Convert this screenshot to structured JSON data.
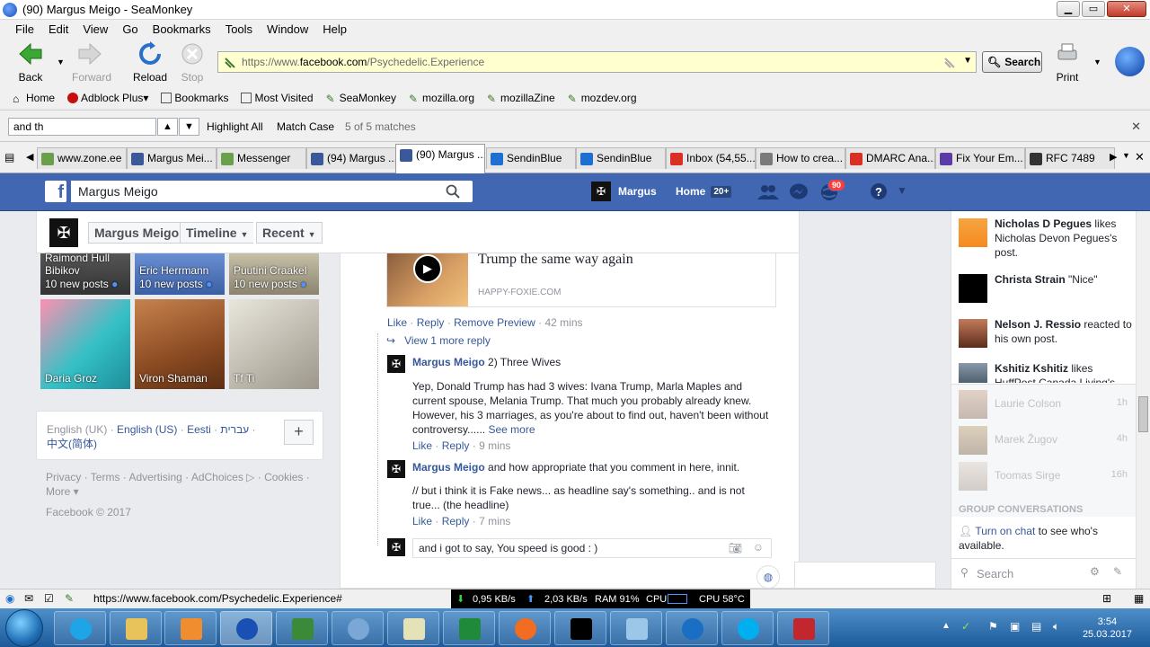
{
  "window": {
    "title": "(90) Margus Meigo - SeaMonkey"
  },
  "menu": [
    "File",
    "Edit",
    "View",
    "Go",
    "Bookmarks",
    "Tools",
    "Window",
    "Help"
  ],
  "nav": {
    "back": "Back",
    "forward": "Forward",
    "reload": "Reload",
    "stop": "Stop",
    "print": "Print",
    "search": "Search"
  },
  "url": {
    "prefix": "https://www.",
    "domain": "facebook.com",
    "path": "/Psychedelic.Experience"
  },
  "bookmarks": [
    "Home",
    "Adblock Plus",
    "Bookmarks",
    "Most Visited",
    "SeaMonkey",
    "mozilla.org",
    "mozillaZine",
    "mozdev.org"
  ],
  "find": {
    "query": "and th",
    "highlight": "Highlight All",
    "match_case": "Match Case",
    "status": "5 of 5 matches"
  },
  "tabs": [
    {
      "label": "www.zone.ee",
      "color": "#6aa04c"
    },
    {
      "label": "Margus Mei...",
      "color": "#3b5998"
    },
    {
      "label": "Messenger",
      "color": "#6aa04c"
    },
    {
      "label": "(94) Margus ...",
      "color": "#3b5998"
    },
    {
      "label": "(90) Margus ...",
      "color": "#3b5998"
    },
    {
      "label": "SendinBlue",
      "color": "#1d6fd0"
    },
    {
      "label": "SendinBlue",
      "color": "#1d6fd0"
    },
    {
      "label": "Inbox (54,55...",
      "color": "#d93025"
    },
    {
      "label": "How to crea...",
      "color": "#7a7a7a"
    },
    {
      "label": "DMARC Ana...",
      "color": "#d93025"
    },
    {
      "label": "Fix Your Em...",
      "color": "#5b3ba8"
    },
    {
      "label": "RFC 7489",
      "color": "#333333"
    }
  ],
  "fb": {
    "search_value": "Margus Meigo",
    "user": "Margus",
    "home": "Home",
    "home_count": "20+",
    "notif_count": "90",
    "crumbs": [
      "Margus Meigo",
      "Timeline",
      "Recent"
    ]
  },
  "left": {
    "groups_top": [
      {
        "title": "Raimond Hull Bibikov",
        "sub": "10 new posts"
      },
      {
        "title": "Eric Herrmann",
        "sub": "10 new posts"
      },
      {
        "title": "Puutini Craakel",
        "sub": "10 new posts"
      }
    ],
    "photos": [
      {
        "caption": "Daria Groz"
      },
      {
        "caption": "Viron Shaman"
      },
      {
        "caption": "Tf Ti"
      }
    ],
    "languages_line1": "English (UK) · ",
    "languages_en": "English (US)",
    "languages_et": "Eesti",
    "languages_he": "עברית",
    "languages_zh": "中文(简体)",
    "footer": "Privacy · Terms · Advertising · AdChoices ▷ · Cookies · More ▾",
    "copyright": "Facebook © 2017"
  },
  "feed": {
    "card_title": "Trump the same way again",
    "card_domain": "HAPPY-FOXIE.COM",
    "actions1": {
      "like": "Like",
      "reply": "Reply",
      "remove": "Remove Preview",
      "time": "42 mins"
    },
    "view_more": "View 1 more reply",
    "reply1": {
      "author": "Margus Meigo",
      "headline": "2) Three Wives",
      "body": "Yep, Donald Trump has had 3 wives: Ivana Trump, Marla Maples and current spouse, Melania Trump. That much you probably already knew. However, his 3 marriages, as you're about to find out, haven't been without controversy......",
      "see_more": "See more",
      "like": "Like",
      "reply": "Reply",
      "time": "9 mins"
    },
    "reply2": {
      "author": "Margus Meigo",
      "text": "and how appropriate that you comment in here, innit.",
      "body": "// but i think it is Fake news... as headline say's something.. and is not true... (the headline)",
      "like": "Like",
      "reply": "Reply",
      "time": "7 mins"
    },
    "composer": "and i got to say, You speed is good : )"
  },
  "ticker": [
    {
      "name": "Nicholas D Pegues",
      "text": "likes Nicholas Devon Pegues's post."
    },
    {
      "name": "Christa Strain",
      "text": "\"Nice\""
    },
    {
      "name": "Nelson J. Ressio",
      "text": "reacted to his own post."
    },
    {
      "name": "Kshitiz Kshitiz",
      "text": "likes HuffPost Canada Living's"
    }
  ],
  "chat": {
    "people": [
      {
        "name": "Laurie Colson",
        "time": "1h"
      },
      {
        "name": "Marek Žugov",
        "time": "4h"
      },
      {
        "name": "Toomas Sirge",
        "time": "16h"
      }
    ],
    "group_heading": "GROUP CONVERSATIONS",
    "turn_on": "Turn on chat",
    "turn_on_rest": "to see who's available.",
    "search_placeholder": "Search"
  },
  "status": {
    "url": "https://www.facebook.com/Psychedelic.Experience#",
    "down": "0,95 KB/s",
    "up": "2,03 KB/s",
    "ram": "RAM 91%",
    "cpu": "CPU",
    "cpu_temp": "CPU 58°C"
  },
  "clock": {
    "time": "3:54",
    "date": "25.03.2017"
  }
}
